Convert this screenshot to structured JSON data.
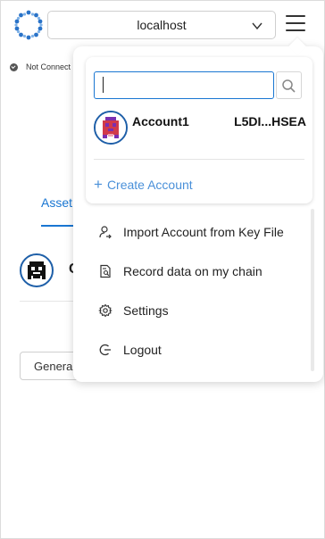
{
  "header": {
    "network": "localhost",
    "logo_icon": "network-logo-icon",
    "menu_icon": "hamburger-menu-icon"
  },
  "status": {
    "connection": "Not Connect"
  },
  "background": {
    "assets_tab": "Asset",
    "asset_letter": "C",
    "generate_button": "Genera"
  },
  "menu": {
    "search": {
      "value": "",
      "placeholder": ""
    },
    "accounts": [
      {
        "name": "Account1",
        "address": "L5DI...HSEA"
      }
    ],
    "create_account": "Create Account",
    "items": [
      {
        "label": "Import Account from Key File",
        "icon": "user-import-icon"
      },
      {
        "label": "Record data on my chain",
        "icon": "document-search-icon"
      },
      {
        "label": "Settings",
        "icon": "gear-icon"
      },
      {
        "label": "Logout",
        "icon": "logout-icon"
      }
    ]
  },
  "colors": {
    "accent": "#1976d2",
    "link": "#4a90d9",
    "avatar_ring": "#1e5fa8"
  }
}
